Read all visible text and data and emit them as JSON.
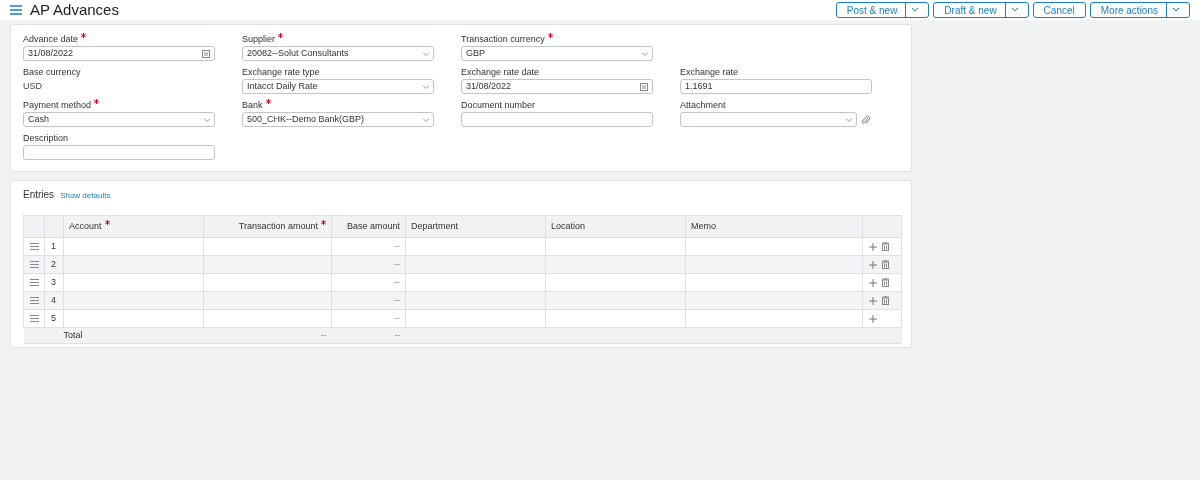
{
  "header": {
    "title": "AP Advances",
    "buttons": [
      {
        "label": "Post & new",
        "split": true
      },
      {
        "label": "Draft & new",
        "split": true
      },
      {
        "label": "Cancel",
        "split": false
      },
      {
        "label": "More actions",
        "split": true
      }
    ]
  },
  "form": {
    "fields": [
      {
        "label": "Advance date",
        "required": true,
        "kind": "date",
        "value": "31/08/2022"
      },
      {
        "label": "Supplier",
        "required": true,
        "kind": "select",
        "value": "20082--Solut Consultants"
      },
      {
        "label": "Transaction currency",
        "required": true,
        "kind": "select",
        "value": "GBP"
      },
      {
        "kind": "blank"
      },
      {
        "label": "Base currency",
        "required": false,
        "kind": "static",
        "value": "USD"
      },
      {
        "label": "Exchange rate type",
        "required": false,
        "kind": "select",
        "value": "Intacct Daily Rate"
      },
      {
        "label": "Exchange rate date",
        "required": false,
        "kind": "date",
        "value": "31/08/2022"
      },
      {
        "label": "Exchange rate",
        "required": false,
        "kind": "text",
        "value": "1.1691"
      },
      {
        "label": "Payment method",
        "required": true,
        "kind": "select",
        "value": "Cash"
      },
      {
        "label": "Bank",
        "required": true,
        "kind": "select",
        "value": "500_CHK--Demo Bank(GBP)"
      },
      {
        "label": "Document number",
        "required": false,
        "kind": "text"
      },
      {
        "label": "Attachment",
        "required": false,
        "kind": "attachment"
      },
      {
        "label": "Description",
        "required": false,
        "kind": "text"
      }
    ]
  },
  "entries": {
    "title": "Entries",
    "link": "Show defaults",
    "columns": [
      {
        "label": "Account",
        "required": true
      },
      {
        "label": "Transaction amount",
        "required": true
      },
      {
        "label": "Base amount",
        "required": false
      },
      {
        "label": "Department",
        "required": false
      },
      {
        "label": "Location",
        "required": false
      },
      {
        "label": "Memo",
        "required": false
      }
    ],
    "rows": [
      {
        "number": "1",
        "base_amount": "--",
        "deletable": true
      },
      {
        "number": "2",
        "base_amount": "--",
        "deletable": true
      },
      {
        "number": "3",
        "base_amount": "--",
        "deletable": true
      },
      {
        "number": "4",
        "base_amount": "--",
        "deletable": true
      },
      {
        "number": "5",
        "base_amount": "--",
        "deletable": false
      }
    ],
    "total": {
      "label": "Total",
      "transaction_amount": "--",
      "base_amount": "--"
    }
  }
}
